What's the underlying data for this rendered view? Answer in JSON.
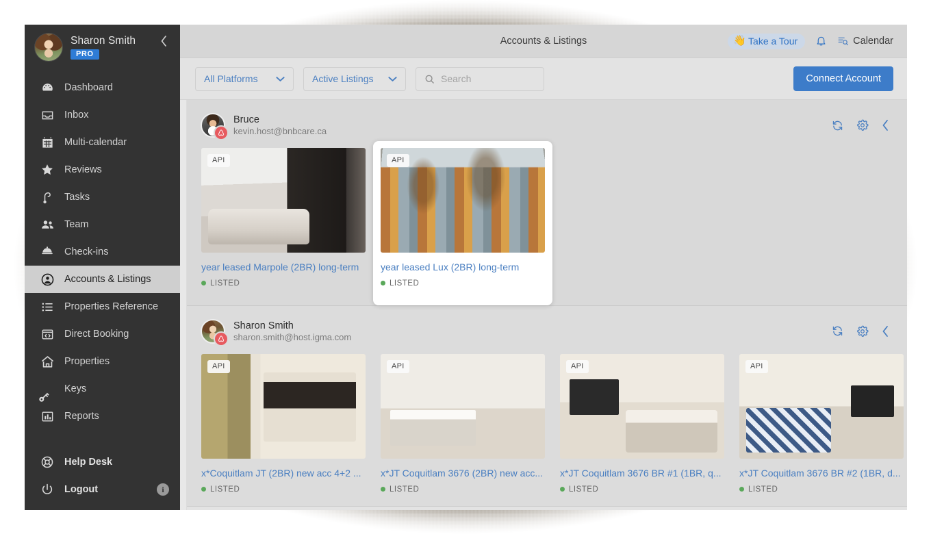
{
  "sidebar": {
    "profile": {
      "name": "Sharon Smith",
      "badge": "PRO",
      "collapse_icon": "chevron-left-icon"
    },
    "items": [
      {
        "label": "Dashboard",
        "icon": "dashboard-icon",
        "active": false
      },
      {
        "label": "Inbox",
        "icon": "inbox-icon",
        "active": false
      },
      {
        "label": "Multi-calendar",
        "icon": "calendar-icon",
        "active": false
      },
      {
        "label": "Reviews",
        "icon": "star-icon",
        "active": false
      },
      {
        "label": "Tasks",
        "icon": "tasks-icon",
        "active": false
      },
      {
        "label": "Team",
        "icon": "team-icon",
        "active": false
      },
      {
        "label": "Check-ins",
        "icon": "bell-service-icon",
        "active": false
      },
      {
        "label": "Accounts & Listings",
        "icon": "account-circle-icon",
        "active": true
      },
      {
        "label": "Properties Reference",
        "icon": "list-icon",
        "active": false
      },
      {
        "label": "Direct Booking",
        "icon": "code-window-icon",
        "active": false
      },
      {
        "label": "Properties",
        "icon": "home-icon",
        "active": false
      },
      {
        "label": "Keys",
        "icon": "key-icon",
        "active": false
      },
      {
        "label": "Reports",
        "icon": "bar-chart-icon",
        "active": false
      }
    ],
    "bottom_items": [
      {
        "label": "Help Desk",
        "icon": "lifebuoy-icon"
      },
      {
        "label": "Logout",
        "icon": "power-icon",
        "info": "i"
      }
    ]
  },
  "topbar": {
    "title": "Accounts & Listings",
    "tour_label": "Take a Tour",
    "tour_icon": "waving-hand-icon",
    "bell_icon": "notification-bell-icon",
    "calendar_label": "Calendar",
    "calendar_icon": "calendar-search-icon"
  },
  "filterbar": {
    "platform_value": "All Platforms",
    "status_value": "Active Listings",
    "search_placeholder": "Search",
    "search_value": "",
    "search_icon": "search-icon",
    "chevron_icon": "chevron-down-icon",
    "connect_label": "Connect Account"
  },
  "accounts": [
    {
      "name": "Bruce",
      "email": "kevin.host@bnbcare.ca",
      "avatar": "bruce-avatar",
      "platform_icon": "airbnb-icon",
      "actions": [
        "refresh-icon",
        "gear-icon",
        "chevron-left-icon"
      ],
      "listings": [
        {
          "badge": "API",
          "title": "year leased Marpole (2BR) long-term",
          "status": "LISTED",
          "photo": "ph-marpole",
          "hovered": false
        },
        {
          "badge": "API",
          "title": "year leased Lux (2BR) long-term",
          "status": "LISTED",
          "photo": "ph-lux",
          "hovered": true
        }
      ]
    },
    {
      "name": "Sharon  Smith",
      "email": "sharon.smith@host.igma.com",
      "avatar": "sharon-avatar",
      "platform_icon": "airbnb-icon",
      "actions": [
        "refresh-icon",
        "gear-icon",
        "chevron-left-icon"
      ],
      "listings": [
        {
          "badge": "API",
          "title": "x*Coquitlam JT (2BR) new acc 4+2 ...",
          "status": "LISTED",
          "photo": "ph-coq1",
          "hovered": false
        },
        {
          "badge": "API",
          "title": "x*JT Coquitlam 3676 (2BR) new acc...",
          "status": "LISTED",
          "photo": "ph-coq2",
          "hovered": false
        },
        {
          "badge": "API",
          "title": "x*JT Coquitlam 3676 BR #1 (1BR, q...",
          "status": "LISTED",
          "photo": "ph-coq3",
          "hovered": false
        },
        {
          "badge": "API",
          "title": "x*JT Coquitlam 3676 BR #2 (1BR, d...",
          "status": "LISTED",
          "photo": "ph-coq4",
          "hovered": false
        }
      ]
    }
  ],
  "colors": {
    "accent_blue": "#4a7fc1",
    "button_blue": "#3d7cc9",
    "sidebar_bg": "#333333",
    "listed_green": "#5aa85a",
    "airbnb_red": "#e75a5f",
    "pro_badge_blue": "#2e7cd6"
  }
}
